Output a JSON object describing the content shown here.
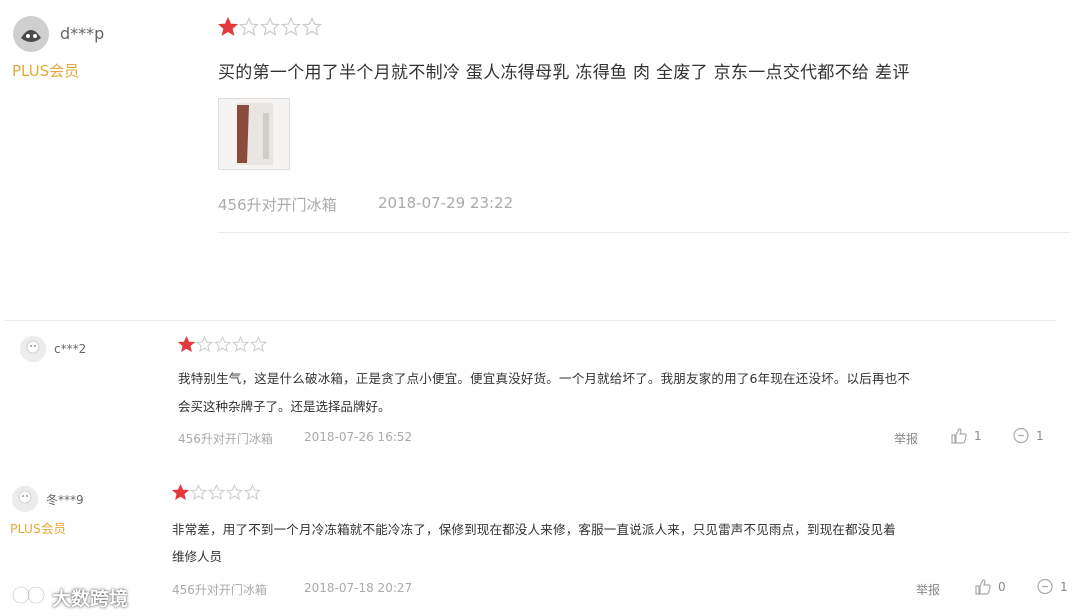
{
  "reviews": [
    {
      "user": "d***p",
      "badge": "PLUS会员",
      "rating": 1,
      "content": "买的第一个用了半个月就不制冷 蛋人冻得母乳 冻得鱼 肉 全废了 京东一点交代都不给 差评",
      "product": "456升对开门冰箱",
      "time": "2018-07-29 23:22"
    },
    {
      "user": "c***2",
      "rating": 1,
      "content_line1": "我特别生气，这是什么破冰箱，正是贪了点小便宜。便宜真没好货。一个月就给坏了。我朋友家的用了6年现在还没坏。以后再也不",
      "content_line2": "会买这种杂牌子了。还是选择品牌好。",
      "product": "456升对开门冰箱",
      "time": "2018-07-26 16:52",
      "report": "举报",
      "likes": "1",
      "replies": "1"
    },
    {
      "user": "冬***9",
      "badge": "PLUS会员",
      "rating": 1,
      "content_line1": "非常差，用了不到一个月冷冻箱就不能冷冻了，保修到现在都没人来修，客服一直说派人来，只见雷声不见雨点，到现在都没见着",
      "content_line2": "维修人员",
      "product": "456升对开门冰箱",
      "time": "2018-07-18 20:27",
      "report": "举报",
      "likes": "0",
      "replies": "1"
    }
  ],
  "watermark": "大数跨境",
  "colors": {
    "star_filled": "#e4393c",
    "star_empty": "#cccccc",
    "plus": "#e4a93a"
  }
}
